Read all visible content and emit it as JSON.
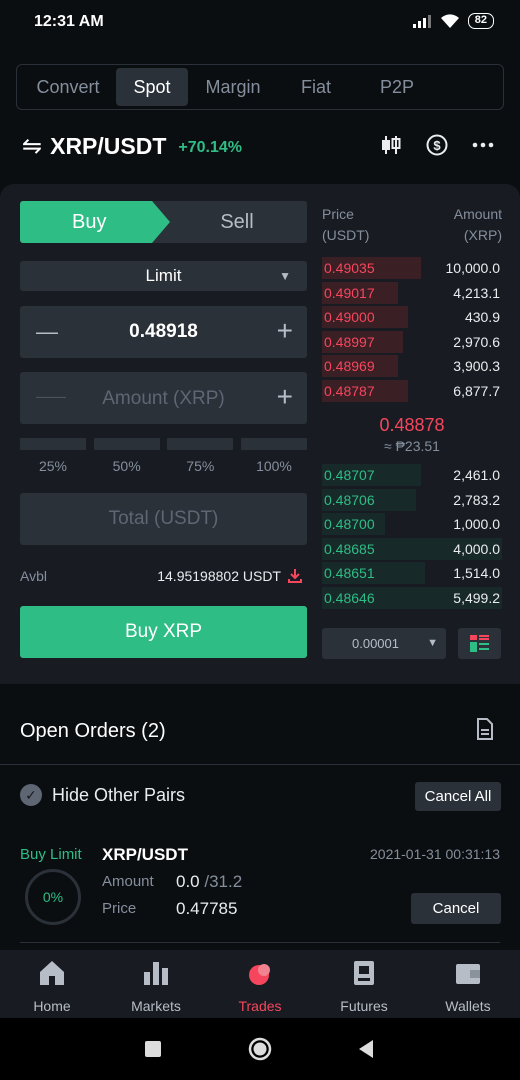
{
  "status": {
    "time": "12:31 AM",
    "battery": "82"
  },
  "tabs": [
    {
      "label": "Convert"
    },
    {
      "label": "Spot"
    },
    {
      "label": "Margin"
    },
    {
      "label": "Fiat"
    },
    {
      "label": "P2P"
    }
  ],
  "pair": {
    "name": "XRP/USDT",
    "change": "+70.14%"
  },
  "trade": {
    "buy_label": "Buy",
    "sell_label": "Sell",
    "order_type": "Limit",
    "price": "0.48918",
    "amount_placeholder": "Amount (XRP)",
    "percents": [
      "25%",
      "50%",
      "75%",
      "100%"
    ],
    "total_placeholder": "Total (USDT)",
    "avbl_label": "Avbl",
    "avbl_value": "14.95198802 USDT",
    "buy_button": "Buy XRP"
  },
  "orderbook": {
    "price_header": "Price",
    "price_unit": "(USDT)",
    "amount_header": "Amount",
    "amount_unit": "(XRP)",
    "asks": [
      {
        "price": "0.49035",
        "amount": "10,000.0",
        "depth": 0.55
      },
      {
        "price": "0.49017",
        "amount": "4,213.1",
        "depth": 0.42
      },
      {
        "price": "0.49000",
        "amount": "430.9",
        "depth": 0.48
      },
      {
        "price": "0.48997",
        "amount": "2,970.6",
        "depth": 0.45
      },
      {
        "price": "0.48969",
        "amount": "3,900.3",
        "depth": 0.42
      },
      {
        "price": "0.48787",
        "amount": "6,877.7",
        "depth": 0.48
      }
    ],
    "last_price": "0.48878",
    "last_price_fiat": "≈ ₱23.51",
    "bids": [
      {
        "price": "0.48707",
        "amount": "2,461.0",
        "depth": 0.55
      },
      {
        "price": "0.48706",
        "amount": "2,783.2",
        "depth": 0.52
      },
      {
        "price": "0.48700",
        "amount": "1,000.0",
        "depth": 0.35
      },
      {
        "price": "0.48685",
        "amount": "4,000.0",
        "depth": 1.0
      },
      {
        "price": "0.48651",
        "amount": "1,514.0",
        "depth": 0.57
      },
      {
        "price": "0.48646",
        "amount": "5,499.2",
        "depth": 1.0
      }
    ],
    "precision": "0.00001"
  },
  "open_orders": {
    "title": "Open Orders (2)",
    "hide_label": "Hide Other Pairs",
    "cancel_all": "Cancel All",
    "order": {
      "side": "Buy Limit",
      "pair": "XRP/USDT",
      "date": "2021-01-31 00:31:13",
      "filled": "0%",
      "amount_label": "Amount",
      "amount_value": "0.0",
      "amount_total": "/31.2",
      "price_label": "Price",
      "price_value": "0.47785",
      "cancel": "Cancel"
    }
  },
  "bottom_nav": [
    {
      "label": "Home"
    },
    {
      "label": "Markets"
    },
    {
      "label": "Trades"
    },
    {
      "label": "Futures"
    },
    {
      "label": "Wallets"
    }
  ],
  "colors": {
    "green": "#2ebd85",
    "red": "#f6465d",
    "bg": "#0b0e11",
    "panel": "#181c22"
  }
}
